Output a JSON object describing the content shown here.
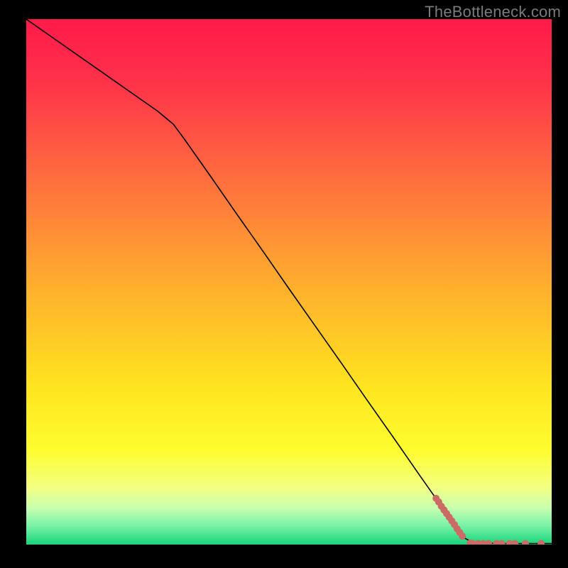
{
  "watermark": "TheBottleneck.com",
  "chart_data": {
    "type": "line",
    "title": "",
    "xlabel": "",
    "ylabel": "",
    "xlim": [
      0,
      100
    ],
    "ylim": [
      0,
      100
    ],
    "grid": false,
    "legend": false,
    "background_gradient": {
      "stops": [
        {
          "offset": 0.0,
          "color": "#ff1a4a"
        },
        {
          "offset": 0.12,
          "color": "#ff3249"
        },
        {
          "offset": 0.3,
          "color": "#ff6c3f"
        },
        {
          "offset": 0.5,
          "color": "#ffac2e"
        },
        {
          "offset": 0.7,
          "color": "#ffe41f"
        },
        {
          "offset": 0.82,
          "color": "#fdfd2e"
        },
        {
          "offset": 0.89,
          "color": "#f4ff80"
        },
        {
          "offset": 0.93,
          "color": "#c9ffb0"
        },
        {
          "offset": 0.965,
          "color": "#76f2a7"
        },
        {
          "offset": 1.0,
          "color": "#16d47a"
        }
      ]
    },
    "series": [
      {
        "name": "bottleneck-curve",
        "color": "#000000",
        "stroke_width": 1.6,
        "points": [
          {
            "x": 0,
            "y": 100
          },
          {
            "x": 5,
            "y": 96.5
          },
          {
            "x": 10,
            "y": 93
          },
          {
            "x": 15,
            "y": 89.5
          },
          {
            "x": 20,
            "y": 86
          },
          {
            "x": 25,
            "y": 82.5
          },
          {
            "x": 28,
            "y": 80
          },
          {
            "x": 30,
            "y": 77.3
          },
          {
            "x": 35,
            "y": 70.2
          },
          {
            "x": 40,
            "y": 63
          },
          {
            "x": 45,
            "y": 55.9
          },
          {
            "x": 50,
            "y": 48.7
          },
          {
            "x": 55,
            "y": 41.6
          },
          {
            "x": 60,
            "y": 34.5
          },
          {
            "x": 65,
            "y": 27.3
          },
          {
            "x": 70,
            "y": 20.2
          },
          {
            "x": 75,
            "y": 13
          },
          {
            "x": 80,
            "y": 5.9
          },
          {
            "x": 82,
            "y": 3.0
          },
          {
            "x": 83.5,
            "y": 1.2
          },
          {
            "x": 85,
            "y": 0.4
          },
          {
            "x": 90,
            "y": 0.2
          },
          {
            "x": 95,
            "y": 0.2
          },
          {
            "x": 100,
            "y": 0.2
          }
        ]
      },
      {
        "name": "data-points",
        "color": "#cc6b66",
        "marker": "circle",
        "marker_radius": 5,
        "points": [
          {
            "x": 78.0,
            "y": 8.8
          },
          {
            "x": 78.5,
            "y": 8.1
          },
          {
            "x": 79.0,
            "y": 7.3
          },
          {
            "x": 79.5,
            "y": 6.6
          },
          {
            "x": 80.0,
            "y": 5.9
          },
          {
            "x": 80.5,
            "y": 5.2
          },
          {
            "x": 81.0,
            "y": 4.5
          },
          {
            "x": 81.5,
            "y": 3.8
          },
          {
            "x": 82.0,
            "y": 3.0
          },
          {
            "x": 82.5,
            "y": 2.3
          },
          {
            "x": 83.0,
            "y": 1.6
          },
          {
            "x": 84.5,
            "y": 0.3
          },
          {
            "x": 85.0,
            "y": 0.2
          },
          {
            "x": 86.0,
            "y": 0.2
          },
          {
            "x": 87.0,
            "y": 0.2
          },
          {
            "x": 88.0,
            "y": 0.2
          },
          {
            "x": 89.5,
            "y": 0.2
          },
          {
            "x": 90.5,
            "y": 0.2
          },
          {
            "x": 92.0,
            "y": 0.2
          },
          {
            "x": 93.0,
            "y": 0.2
          },
          {
            "x": 95.0,
            "y": 0.2
          },
          {
            "x": 98.0,
            "y": 0.2
          }
        ]
      }
    ]
  }
}
